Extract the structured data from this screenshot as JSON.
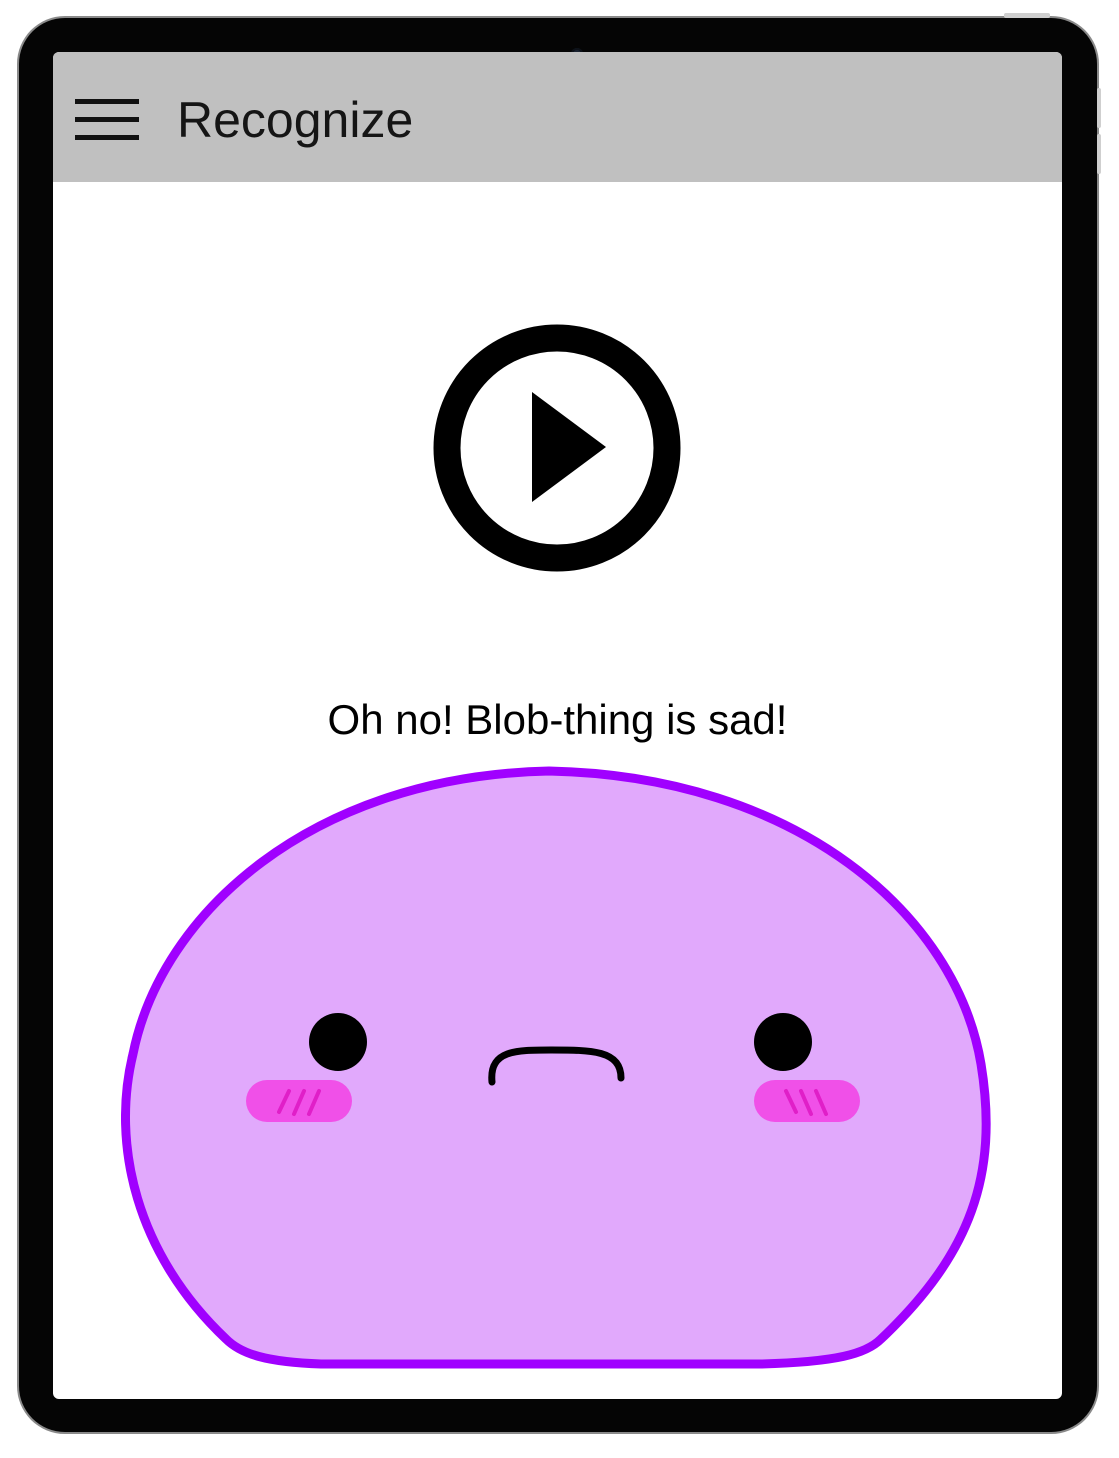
{
  "app_bar": {
    "title": "Recognize",
    "menu_icon": "hamburger-menu-icon",
    "background": "#c0c0c0"
  },
  "player": {
    "icon": "play-icon"
  },
  "message": {
    "text": "Oh no! Blob-thing is sad!"
  },
  "blob": {
    "mood": "sad",
    "fill": "#e1a9fc",
    "outline": "#a000ff",
    "blush": "#f050e8"
  }
}
